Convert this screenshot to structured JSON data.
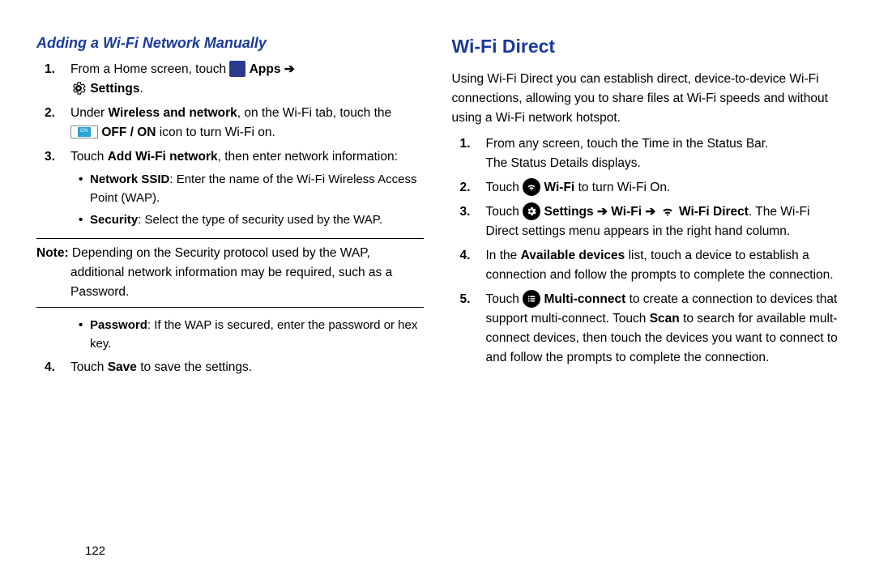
{
  "left": {
    "section_title": "Adding a Wi-Fi Network Manually",
    "step1_a": "From a Home screen, touch",
    "step1_apps": "Apps",
    "step1_arrow": "➔",
    "step1_settings": "Settings",
    "step1_dot": ".",
    "step2_a": "Under",
    "step2_b": "Wireless and network",
    "step2_c": ", on the Wi-Fi tab, touch the",
    "step2_d": "OFF / ON",
    "step2_e": "icon to turn Wi-Fi on.",
    "step3_a": "Touch",
    "step3_b": "Add Wi-Fi network",
    "step3_c": ", then enter network information:",
    "bullet1_a": "Network SSID",
    "bullet1_b": ": Enter the name of the Wi-Fi Wireless Access Point (WAP).",
    "bullet2_a": "Security",
    "bullet2_b": ": Select the type of security used by the WAP.",
    "note_label": "Note:",
    "note_text": "Depending on the Security protocol used by the WAP, additional network information may be required, such as a Password.",
    "bullet3_a": "Password",
    "bullet3_b": ": If the WAP is secured, enter the password or hex key.",
    "step4_a": "Touch",
    "step4_b": "Save",
    "step4_c": "to save the settings."
  },
  "right": {
    "title": "Wi-Fi Direct",
    "intro": "Using Wi-Fi Direct you can establish direct, device-to-device Wi-Fi connections, allowing you to share files at Wi-Fi speeds and without using a Wi-Fi network hotspot.",
    "step1_a": "From any screen, touch the Time in the Status Bar.",
    "step1_b": "The Status Details displays.",
    "step2_a": "Touch",
    "step2_b": "Wi-Fi",
    "step2_c": "to turn Wi-Fi On.",
    "step3_a": "Touch",
    "step3_b": "Settings",
    "step3_arrow": "➔",
    "step3_c": "Wi-Fi",
    "step3_d": "Wi-Fi Direct",
    "step3_e": ". The Wi-Fi Direct settings menu appears in the right hand column.",
    "step4_a": "In the",
    "step4_b": "Available devices",
    "step4_c": "list, touch a device to establish a connection and follow the prompts to complete the connection.",
    "step5_a": "Touch",
    "step5_b": "Multi-connect",
    "step5_c": "to create a connection to devices that support multi-connect. Touch",
    "step5_d": "Scan",
    "step5_e": "to search for available mult-connect devices, then touch the devices you want to connect to and follow the prompts to complete the connection."
  },
  "page_number": "122",
  "on_label": "ON"
}
